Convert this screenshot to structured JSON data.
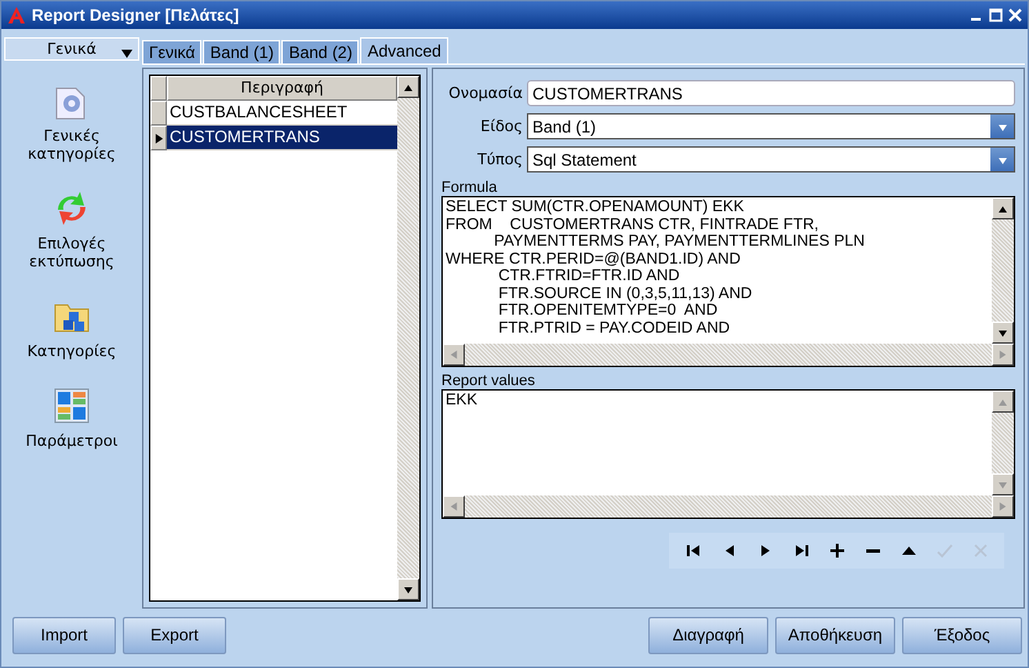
{
  "window": {
    "title": "Report Designer [Πελάτες]"
  },
  "sidebar": {
    "header": "Γενικά",
    "items": [
      {
        "kind": "gear",
        "label": "Γενικές κατηγορίες"
      },
      {
        "kind": "arrows",
        "label": "Επιλογές εκτύπωσης"
      },
      {
        "kind": "folder",
        "label": "Κατηγορίες"
      },
      {
        "kind": "grid",
        "label": "Παράμετροι"
      }
    ]
  },
  "tabs": [
    {
      "label": "Γενικά",
      "selected": false
    },
    {
      "label": "Band (1)",
      "selected": false
    },
    {
      "label": "Band (2)",
      "selected": false
    },
    {
      "label": "Advanced",
      "selected": true
    }
  ],
  "table": {
    "columns": [
      "Περιγραφή"
    ],
    "rows": [
      {
        "cells": [
          "CUSTBALANCESHEET"
        ],
        "selected": false
      },
      {
        "cells": [
          "CUSTOMERTRANS"
        ],
        "selected": true
      }
    ]
  },
  "form": {
    "name": {
      "label": "Ονομασία",
      "value": "CUSTOMERTRANS"
    },
    "kind": {
      "label": "Είδος",
      "value": "Band (1)"
    },
    "type": {
      "label": "Τύπος",
      "value": "Sql Statement"
    },
    "formula": {
      "label": "Formula",
      "lines": [
        "SELECT SUM(CTR.OPENAMOUNT) EKK",
        "FROM    CUSTOMERTRANS CTR, FINTRADE FTR,",
        "           PAYMENTTERMS PAY, PAYMENTTERMLINES PLN",
        "WHERE CTR.PERID=@(BAND1.ID) AND",
        "            CTR.FTRID=FTR.ID AND",
        "            FTR.SOURCE IN (0,3,5,11,13) AND",
        "            FTR.OPENITEMTYPE=0  AND",
        "            FTR.PTRID = PAY.CODEID AND"
      ]
    },
    "report_values": {
      "label": "Report values",
      "lines": [
        "EKK"
      ]
    }
  },
  "navigator": [
    {
      "kind": "first",
      "disabled": false
    },
    {
      "kind": "prior",
      "disabled": false
    },
    {
      "kind": "next",
      "disabled": false
    },
    {
      "kind": "last",
      "disabled": false
    },
    {
      "kind": "insert",
      "disabled": false
    },
    {
      "kind": "delete",
      "disabled": false
    },
    {
      "kind": "edit",
      "disabled": false
    },
    {
      "kind": "post",
      "disabled": true
    },
    {
      "kind": "cancel",
      "disabled": true
    }
  ],
  "buttons_left": [
    "Import",
    "Export"
  ],
  "buttons_right": [
    "Διαγραφή",
    "Αποθήκευση",
    "Έξοδος"
  ]
}
